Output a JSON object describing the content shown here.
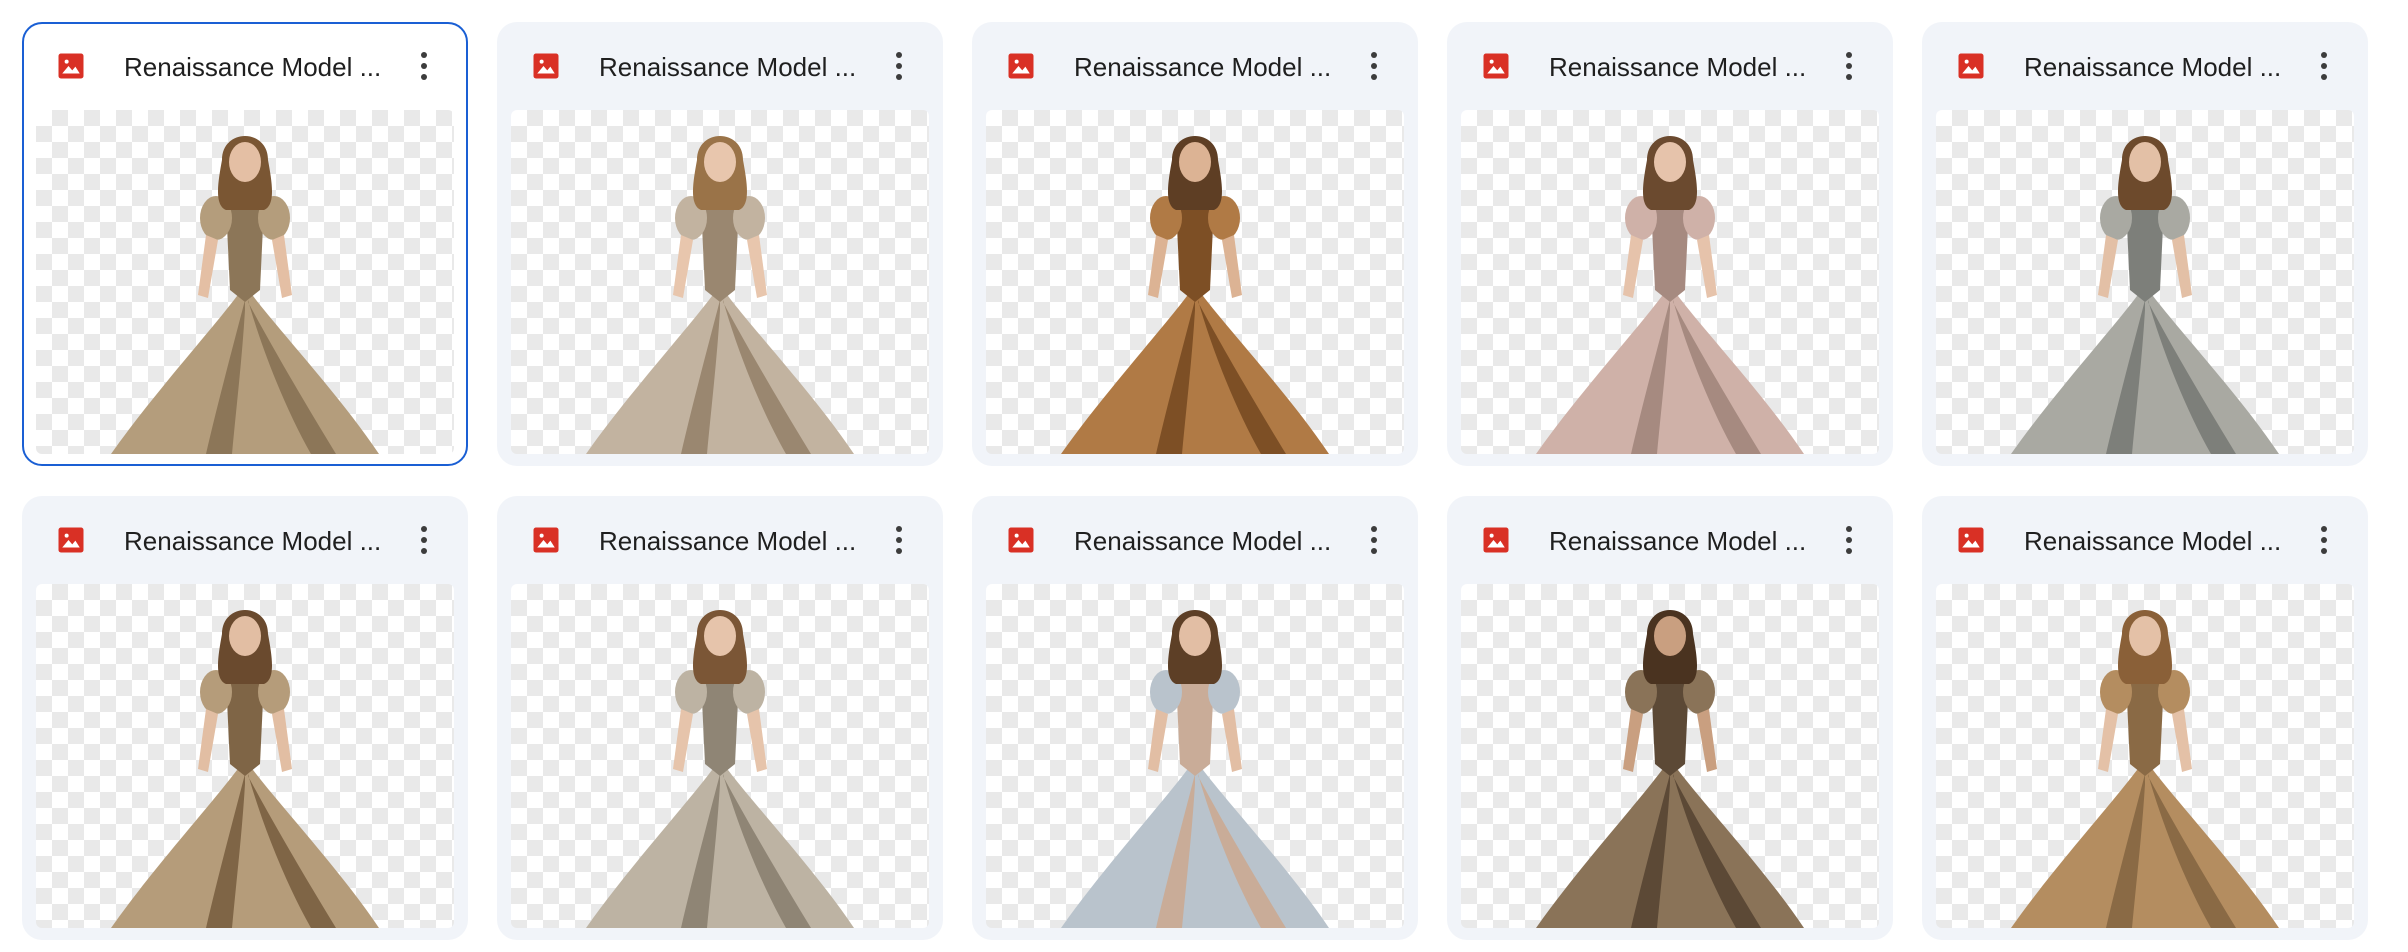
{
  "files": [
    {
      "title": "Renaissance Model ...",
      "icon": "image-file-icon",
      "selected": true,
      "dress": "#b49d7c",
      "dress_shade": "#8c7658",
      "hair": "#7a5633",
      "skin": "#e4bfa4"
    },
    {
      "title": "Renaissance Model ...",
      "icon": "image-file-icon",
      "selected": false,
      "dress": "#c2b3a0",
      "dress_shade": "#9a8770",
      "hair": "#9a7348",
      "skin": "#e8c6ad"
    },
    {
      "title": "Renaissance Model ...",
      "icon": "image-file-icon",
      "selected": false,
      "dress": "#b07a45",
      "dress_shade": "#7d4f25",
      "hair": "#5e3e24",
      "skin": "#dcb394"
    },
    {
      "title": "Renaissance Model ...",
      "icon": "image-file-icon",
      "selected": false,
      "dress": "#cfb1a8",
      "dress_shade": "#a68a80",
      "hair": "#6b4a2f",
      "skin": "#e6c3ab"
    },
    {
      "title": "Renaissance Model ...",
      "icon": "image-file-icon",
      "selected": false,
      "dress": "#a9a9a2",
      "dress_shade": "#7d7f7a",
      "hair": "#6d4a2c",
      "skin": "#e3c0a6"
    },
    {
      "title": "Renaissance Model ...",
      "icon": "image-file-icon",
      "selected": false,
      "dress": "#b59c7a",
      "dress_shade": "#7f6546",
      "hair": "#6a4a2e",
      "skin": "#e2bea3"
    },
    {
      "title": "Renaissance Model ...",
      "icon": "image-file-icon",
      "selected": false,
      "dress": "#bdb3a3",
      "dress_shade": "#8f8575",
      "hair": "#7b5636",
      "skin": "#e6c4ab"
    },
    {
      "title": "Renaissance Model ...",
      "icon": "image-file-icon",
      "selected": false,
      "dress": "#b9c3cc",
      "dress_shade": "#c9ac98",
      "hair": "#5d3f26",
      "skin": "#e2bea4"
    },
    {
      "title": "Renaissance Model ...",
      "icon": "image-file-icon",
      "selected": false,
      "dress": "#8a7358",
      "dress_shade": "#5c4936",
      "hair": "#4a3320",
      "skin": "#c99f80"
    },
    {
      "title": "Renaissance Model ...",
      "icon": "image-file-icon",
      "selected": false,
      "dress": "#b48d60",
      "dress_shade": "#8a6a45",
      "hair": "#8a6038",
      "skin": "#e4c1a7"
    }
  ],
  "colors": {
    "accent": "#1a5fd4",
    "card_bg": "#f1f4f9",
    "image_icon": "#d93025",
    "more_icon": "#3c3c3c"
  },
  "more_icon": "more-vert-icon"
}
